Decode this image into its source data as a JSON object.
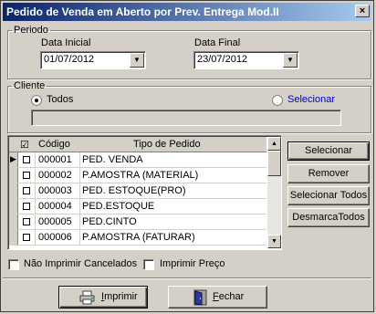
{
  "window": {
    "title": "Pedido de Venda em Aberto por Prev. Entrega Mod.II",
    "close_glyph": "×"
  },
  "periodo": {
    "legend": "Periodo",
    "data_inicial_label": "Data Inicial",
    "data_inicial_value": "01/07/2012",
    "data_final_label": "Data Final",
    "data_final_value": "23/07/2012",
    "dropdown_glyph": "▼"
  },
  "cliente": {
    "legend": "Cliente",
    "todos_label": "Todos",
    "selecionar_label": "Selecionar",
    "selected": "todos",
    "field_value": ""
  },
  "grid": {
    "headers": {
      "check": "☑",
      "codigo": "Código",
      "tipo": "Tipo de Pedido"
    },
    "row_indicator": "▶",
    "rows": [
      {
        "codigo": "000001",
        "tipo": "PED. VENDA",
        "checked": false
      },
      {
        "codigo": "000002",
        "tipo": "P.AMOSTRA (MATERIAL)",
        "checked": false
      },
      {
        "codigo": "000003",
        "tipo": "PED. ESTOQUE(PRO)",
        "checked": false
      },
      {
        "codigo": "000004",
        "tipo": "PED.ESTOQUE",
        "checked": false
      },
      {
        "codigo": "000005",
        "tipo": "PED.CINTO",
        "checked": false
      },
      {
        "codigo": "000006",
        "tipo": "P.AMOSTRA (FATURAR)",
        "checked": false
      }
    ],
    "scroll_up": "▲",
    "scroll_down": "▼"
  },
  "side_buttons": {
    "selecionar": "Selecionar",
    "remover": "Remover",
    "selecionar_todos": "Selecionar Todos",
    "desmarca_todos": "DesmarcaTodos"
  },
  "options": {
    "nao_imprimir_cancelados": "Não Imprimir Cancelados",
    "imprimir_preco": "Imprimir Preço"
  },
  "footer": {
    "imprimir_hot": "I",
    "imprimir_rest": "mprimir",
    "fechar_hot": "F",
    "fechar_rest": "echar"
  }
}
